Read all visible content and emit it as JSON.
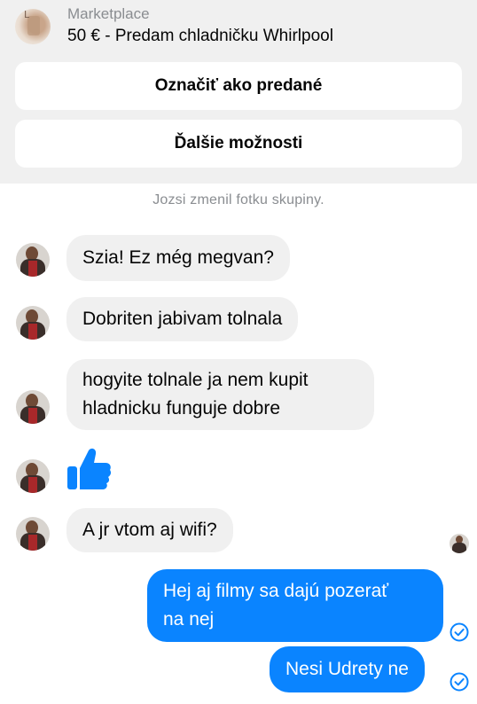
{
  "listing": {
    "label": "Marketplace",
    "title": "50 € - Predam chladničku Whirlpool",
    "thumb_mark": "L"
  },
  "actions": {
    "mark_sold": "Označiť ako predané",
    "more_options": "Ďalšie možnosti"
  },
  "system_message": "Jozsi zmenil fotku skupiny.",
  "incoming": [
    {
      "text": "Szia! Ez még megvan?"
    },
    {
      "text": "Dobriten  jabivam tolnala"
    },
    {
      "line1": "hogyite tolnale ja  nem kupit",
      "line2": "hladnicku funguje dobre"
    },
    {
      "type": "like",
      "icon": "thumbs-up-icon"
    },
    {
      "text": "A jr vtom aj wifi?"
    }
  ],
  "outgoing": [
    {
      "line1": "Hej aj filmy sa dajú pozerať",
      "line2": "na nej"
    },
    {
      "text": "Nesi Udrety ne"
    }
  ],
  "colors": {
    "outgoing_bubble": "#0a84ff",
    "incoming_bubble": "#f0f0f0",
    "header_bg": "#f0f0f0"
  }
}
